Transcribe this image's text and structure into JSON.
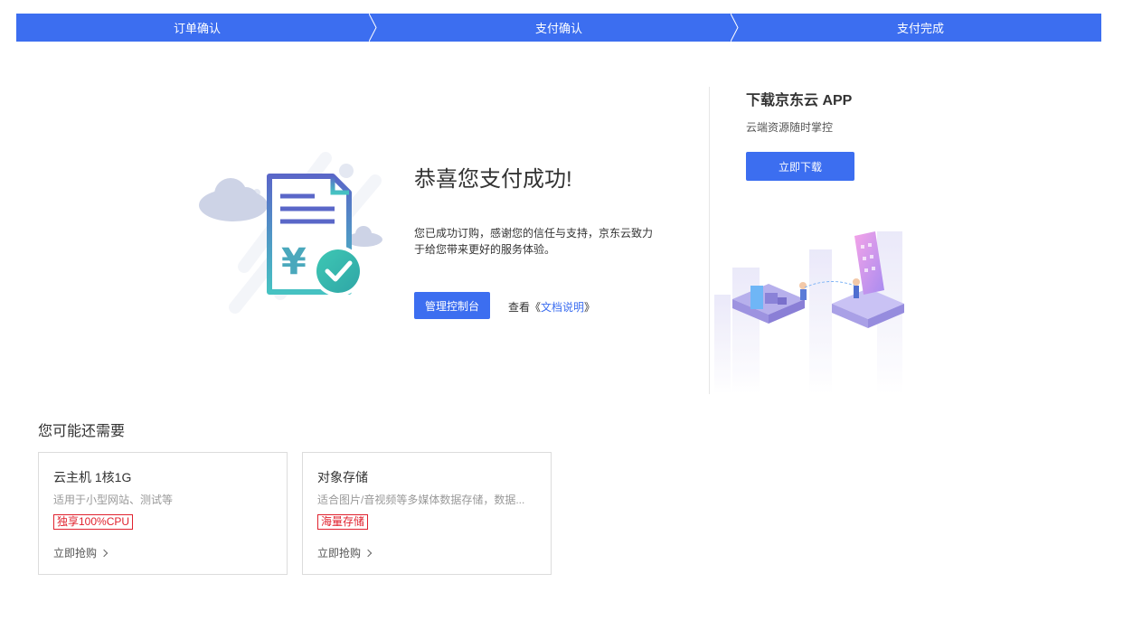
{
  "steps": [
    "订单确认",
    "支付确认",
    "支付完成"
  ],
  "colors": {
    "accent": "#3c6ef0",
    "tag": "#e0222e"
  },
  "success": {
    "title": "恭喜您支付成功!",
    "description": "您已成功订购，感谢您的信任与支持，京东云致力于给您带来更好的服务体验。",
    "console_button": "管理控制台",
    "doc_prefix": "查看《",
    "doc_link": "文档说明",
    "doc_suffix": "》"
  },
  "app": {
    "title": "下载京东云 APP",
    "subtitle": "云端资源随时掌控",
    "download_button": "立即下载"
  },
  "recommend": {
    "title": "您可能还需要",
    "cards": [
      {
        "name": "云主机 1核1G",
        "desc": "适用于小型网站、测试等",
        "tag": "独享100%CPU",
        "link": "立即抢购"
      },
      {
        "name": "对象存储",
        "desc": "适合图片/音视频等多媒体数据存储，数据...",
        "tag": "海量存储",
        "link": "立即抢购"
      }
    ]
  },
  "icons": [
    "cloud-icon",
    "invoice-yuan-icon",
    "check-circle-icon",
    "chevron-right-icon"
  ]
}
